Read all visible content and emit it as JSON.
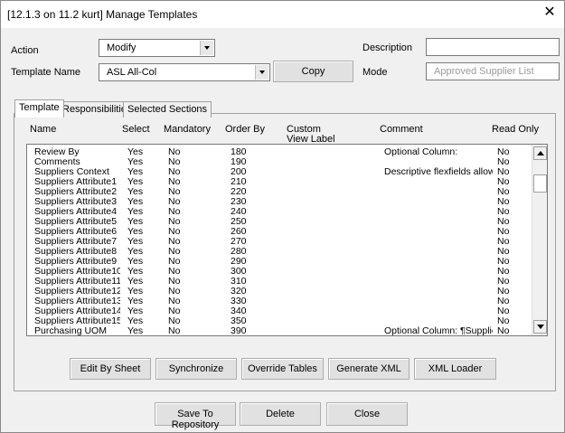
{
  "window": {
    "title": "[12.1.3 on 11.2 kurt] Manage Templates",
    "close_glyph": "✕"
  },
  "form": {
    "action_label": "Action",
    "action_value": "Modify",
    "template_name_label": "Template Name",
    "template_name_value": "ASL All-Col",
    "copy_button": "Copy",
    "description_label": "Description",
    "description_value": "",
    "mode_label": "Mode",
    "mode_value": "Approved Supplier List"
  },
  "tabs": [
    {
      "label": "Template",
      "active": true
    },
    {
      "label": "Responsibilities",
      "active": false
    },
    {
      "label": "Selected Sections",
      "active": false
    }
  ],
  "columns": {
    "name": "Name",
    "select": "Select",
    "mandatory": "Mandatory",
    "order_by": "Order By",
    "custom_view_label_1": "Custom",
    "custom_view_label_2": "View Label",
    "comment": "Comment",
    "read_only": "Read Only"
  },
  "rows": [
    {
      "name": "Review By",
      "select": "Yes",
      "mandatory": "No",
      "order": "180",
      "comment": "Optional Column:",
      "read_only": "No"
    },
    {
      "name": "Comments",
      "select": "Yes",
      "mandatory": "No",
      "order": "190",
      "comment": "",
      "read_only": "No"
    },
    {
      "name": "Suppliers Context",
      "select": "Yes",
      "mandatory": "No",
      "order": "200",
      "comment": "Descriptive flexfields allow yo",
      "read_only": "No"
    },
    {
      "name": "Suppliers Attribute1",
      "select": "Yes",
      "mandatory": "No",
      "order": "210",
      "comment": "",
      "read_only": "No"
    },
    {
      "name": "Suppliers Attribute2",
      "select": "Yes",
      "mandatory": "No",
      "order": "220",
      "comment": "",
      "read_only": "No"
    },
    {
      "name": "Suppliers Attribute3",
      "select": "Yes",
      "mandatory": "No",
      "order": "230",
      "comment": "",
      "read_only": "No"
    },
    {
      "name": "Suppliers Attribute4",
      "select": "Yes",
      "mandatory": "No",
      "order": "240",
      "comment": "",
      "read_only": "No"
    },
    {
      "name": "Suppliers Attribute5",
      "select": "Yes",
      "mandatory": "No",
      "order": "250",
      "comment": "",
      "read_only": "No"
    },
    {
      "name": "Suppliers Attribute6",
      "select": "Yes",
      "mandatory": "No",
      "order": "260",
      "comment": "",
      "read_only": "No"
    },
    {
      "name": "Suppliers Attribute7",
      "select": "Yes",
      "mandatory": "No",
      "order": "270",
      "comment": "",
      "read_only": "No"
    },
    {
      "name": "Suppliers Attribute8",
      "select": "Yes",
      "mandatory": "No",
      "order": "280",
      "comment": "",
      "read_only": "No"
    },
    {
      "name": "Suppliers Attribute9",
      "select": "Yes",
      "mandatory": "No",
      "order": "290",
      "comment": "",
      "read_only": "No"
    },
    {
      "name": "Suppliers Attribute10",
      "select": "Yes",
      "mandatory": "No",
      "order": "300",
      "comment": "",
      "read_only": "No"
    },
    {
      "name": "Suppliers Attribute11",
      "select": "Yes",
      "mandatory": "No",
      "order": "310",
      "comment": "",
      "read_only": "No"
    },
    {
      "name": "Suppliers Attribute12",
      "select": "Yes",
      "mandatory": "No",
      "order": "320",
      "comment": "",
      "read_only": "No"
    },
    {
      "name": "Suppliers Attribute13",
      "select": "Yes",
      "mandatory": "No",
      "order": "330",
      "comment": "",
      "read_only": "No"
    },
    {
      "name": "Suppliers Attribute14",
      "select": "Yes",
      "mandatory": "No",
      "order": "340",
      "comment": "",
      "read_only": "No"
    },
    {
      "name": "Suppliers Attribute15",
      "select": "Yes",
      "mandatory": "No",
      "order": "350",
      "comment": "",
      "read_only": "No"
    },
    {
      "name": "Purchasing UOM",
      "select": "Yes",
      "mandatory": "No",
      "order": "390",
      "comment": "Optional Column:  ¶Supplier u",
      "read_only": "No"
    }
  ],
  "tab_buttons": {
    "edit_by_sheet": "Edit By Sheet",
    "synchronize": "Synchronize",
    "override_tables": "Override Tables",
    "generate_xml": "Generate XML",
    "xml_loader": "XML Loader"
  },
  "bottom_buttons": {
    "save": "Save To Repository",
    "delete": "Delete",
    "close": "Close"
  }
}
